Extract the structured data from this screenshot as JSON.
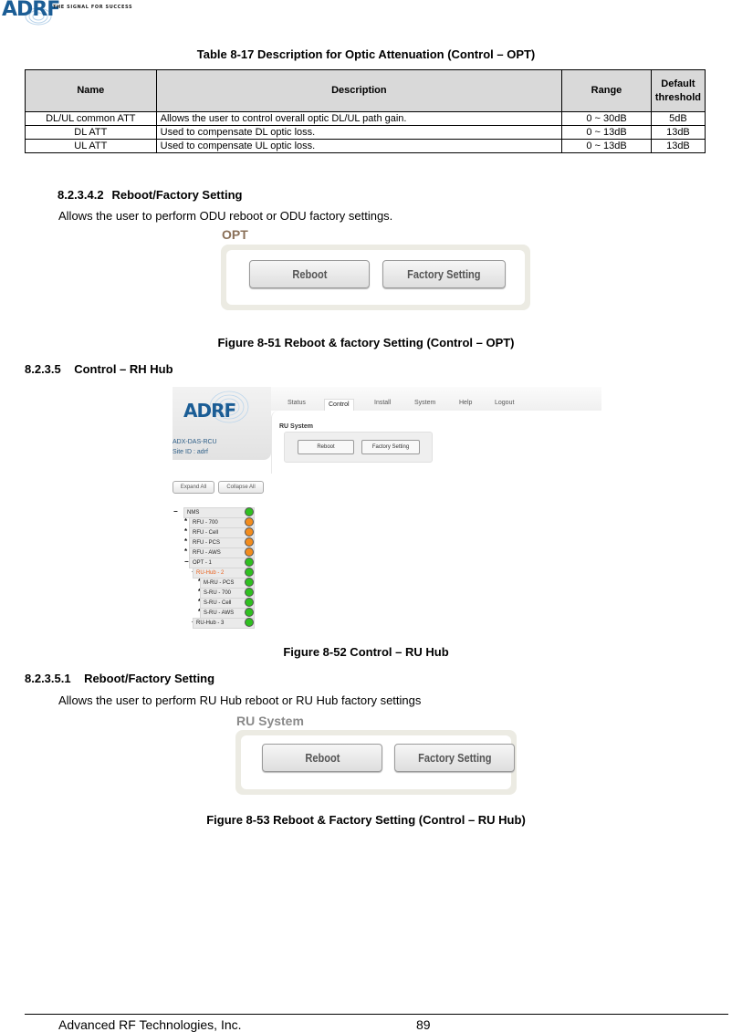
{
  "header": {
    "logo_text": "ADRF",
    "tagline": "THE SIGNAL FOR SUCCESS"
  },
  "table": {
    "caption": "Table 8-17     Description for Optic Attenuation (Control – OPT)",
    "columns": [
      "Name",
      "Description",
      "Range",
      "Default threshold"
    ],
    "rows": [
      {
        "name": "DL/UL common ATT",
        "description": "Allows the user to control overall optic DL/UL path gain.",
        "range": "0 ~ 30dB",
        "default": "5dB"
      },
      {
        "name": "DL ATT",
        "description": "Used to compensate DL optic loss.",
        "range": "0 ~ 13dB",
        "default": "13dB"
      },
      {
        "name": "UL ATT",
        "description": "Used to compensate UL optic loss.",
        "range": "0 ~ 13dB",
        "default": "13dB"
      }
    ]
  },
  "section_opt": {
    "number": "8.2.3.4.2",
    "title": "Reboot/Factory Setting",
    "body": "Allows the user to perform ODU reboot or ODU factory settings.",
    "figure": {
      "panel_title": "OPT",
      "reboot_label": "Reboot",
      "factory_label": "Factory Setting",
      "caption": "Figure 8-51    Reboot & factory Setting (Control – OPT)"
    }
  },
  "section_ruhub": {
    "number": "8.2.3.5",
    "title": "Control – RH Hub",
    "figure": {
      "app": {
        "logo_text": "ADRF",
        "model": "ADX-DAS-RCU",
        "site_id": "Site ID : adrf",
        "tabs": [
          "Status",
          "Control",
          "Install",
          "System",
          "Help",
          "Logout"
        ],
        "active_tab": "Control",
        "section_title": "RU System",
        "reboot_label": "Reboot",
        "factory_label": "Factory Setting",
        "expand_all": "Expand All",
        "collapse_all": "Collapse All",
        "tree": [
          {
            "label": "NMS",
            "toggle": "−",
            "level": 0,
            "status": "green"
          },
          {
            "label": "RFU - 700",
            "toggle": "*",
            "level": 1,
            "status": "orange"
          },
          {
            "label": "RFU - Cell",
            "toggle": "*",
            "level": 1,
            "status": "orange"
          },
          {
            "label": "RFU - PCS",
            "toggle": "*",
            "level": 1,
            "status": "orange"
          },
          {
            "label": "RFU - AWS",
            "toggle": "*",
            "level": 1,
            "status": "orange"
          },
          {
            "label": "OPT - 1",
            "toggle": "−",
            "level": 1,
            "status": "green"
          },
          {
            "label": "RU-Hub - 2",
            "toggle": "−",
            "level": 2,
            "status": "green",
            "selected": true
          },
          {
            "label": "M-RU - PCS",
            "toggle": "*",
            "level": 3,
            "status": "green"
          },
          {
            "label": "S-RU - 700",
            "toggle": "*",
            "level": 3,
            "status": "green"
          },
          {
            "label": "S-RU - Cell",
            "toggle": "*",
            "level": 3,
            "status": "green"
          },
          {
            "label": "S-RU - AWS",
            "toggle": "*",
            "level": 3,
            "status": "green"
          },
          {
            "label": "RU-Hub - 3",
            "toggle": "+",
            "level": 2,
            "status": "green"
          }
        ]
      },
      "caption": "Figure 8-52    Control – RU Hub"
    }
  },
  "section_ruhub_reboot": {
    "number": "8.2.3.5.1",
    "title": "Reboot/Factory Setting",
    "body": "Allows the user to perform RU Hub reboot or RU Hub factory settings",
    "figure": {
      "panel_title": "RU System",
      "reboot_label": "Reboot",
      "factory_label": "Factory Setting",
      "caption": "Figure 8-53    Reboot & Factory Setting (Control – RU Hub)"
    }
  },
  "colors": {
    "led_green": "#2fbf20",
    "led_orange": "#f28c1e",
    "brand_blue": "#1b5d95",
    "selected_node": "#e8601c"
  },
  "footer": {
    "company": "Advanced RF Technologies, Inc.",
    "page": "89"
  }
}
